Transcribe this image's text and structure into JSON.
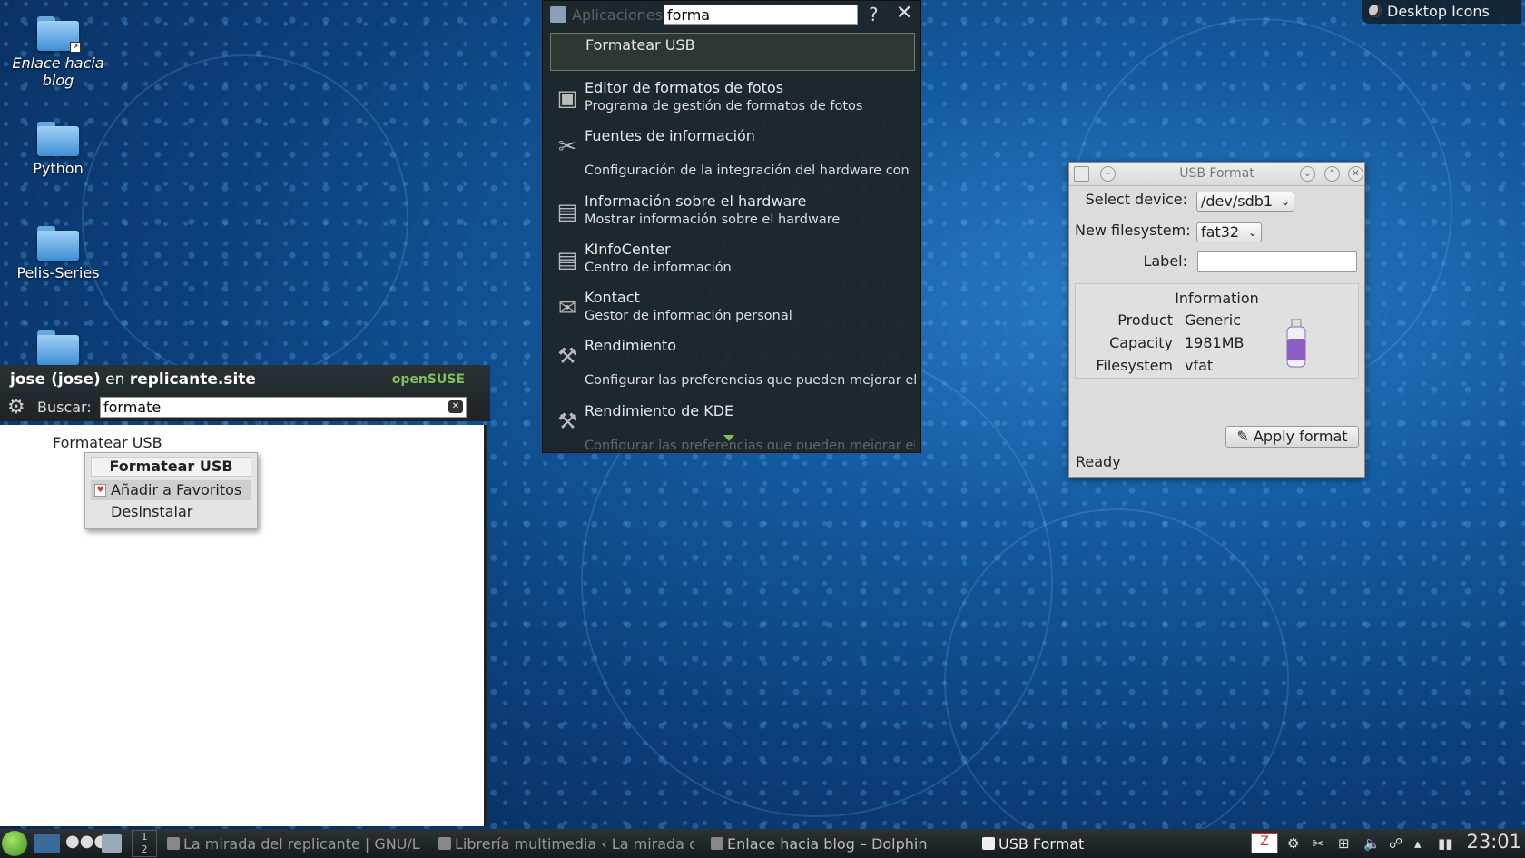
{
  "desktop": {
    "icons": [
      {
        "label": "Enlace hacia blog"
      },
      {
        "label": "Python"
      },
      {
        "label": "Pelis-Series"
      }
    ],
    "toolbox_label": "Desktop Icons"
  },
  "runner": {
    "header_label": "Aplicaciones",
    "query": "forma",
    "help_glyph": "?",
    "close_glyph": "✕",
    "results": [
      {
        "title": "Formatear USB",
        "subtitle": ""
      },
      {
        "title": "Editor de formatos de fotos",
        "subtitle": "Programa de gestión de formatos de fotos"
      },
      {
        "title": "Fuentes de información",
        "subtitle": "Configuración de la integración del hardware con"
      },
      {
        "title": "Información sobre el hardware",
        "subtitle": "Mostrar información sobre el hardware"
      },
      {
        "title": "KInfoCenter",
        "subtitle": "Centro de información"
      },
      {
        "title": "Kontact",
        "subtitle": "Gestor de información personal"
      },
      {
        "title": "Rendimiento",
        "subtitle": "Configurar las preferencias que pueden mejorar el"
      },
      {
        "title": "Rendimiento de KDE",
        "subtitle": "Configurar las preferencias que pueden mejorar el"
      }
    ]
  },
  "kickoff": {
    "user_prefix": "jose (jose)",
    "user_mid": " en ",
    "host": "replicante.site",
    "brand": "openSUSE",
    "search_label": "Buscar:",
    "search_value": "formate",
    "result": "Formatear USB"
  },
  "context_menu": {
    "title": "Formatear USB",
    "items": [
      "Añadir a Favoritos",
      "Desinstalar"
    ]
  },
  "usb_format": {
    "window_title": "USB Format",
    "select_device_label": "Select device:",
    "device_value": "/dev/sdb1",
    "filesystem_label": "New filesystem:",
    "filesystem_value": "fat32",
    "label_label": "Label:",
    "label_value": "",
    "info_title": "Information",
    "product_label": "Product",
    "product_value": "Generic",
    "capacity_label": "Capacity",
    "capacity_value": "1981MB",
    "fs_label": "Filesystem",
    "fs_value": "vfat",
    "apply_label": "Apply format",
    "status": "Ready"
  },
  "taskbar": {
    "pager_1": "1",
    "pager_2": "2",
    "tasks": [
      "La mirada del replicante | GNU/Lin",
      "Librería multimedia ‹ La mirada de",
      "Enlace hacia blog – Dolphin",
      "USB Format"
    ],
    "clock": "23:01"
  }
}
